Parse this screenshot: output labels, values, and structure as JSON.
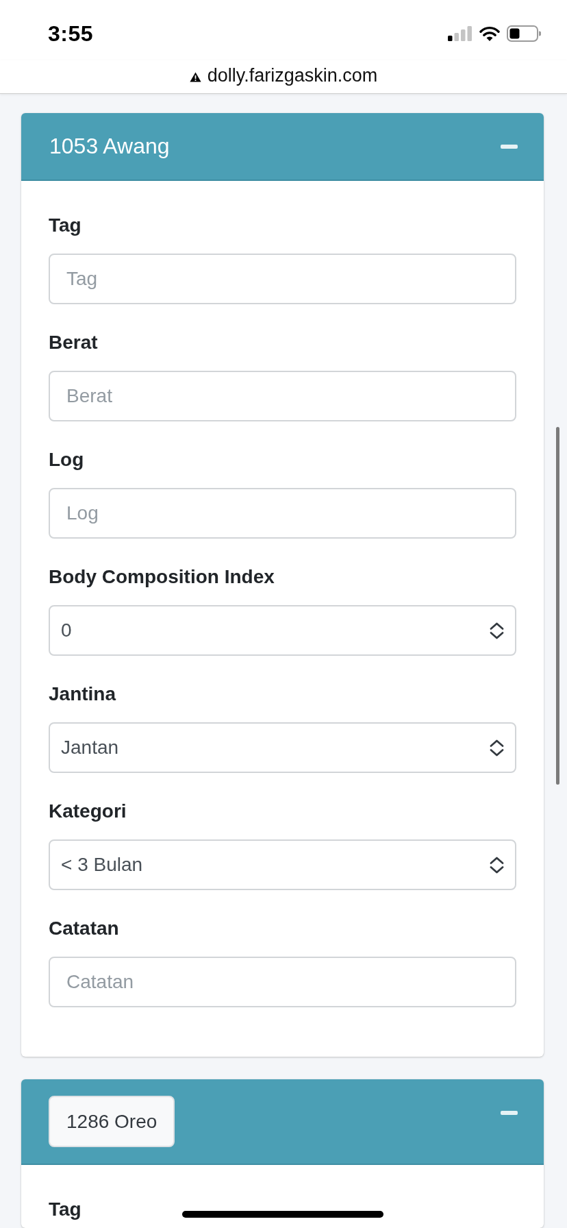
{
  "status_bar": {
    "time": "3:55"
  },
  "address_bar": {
    "url": "dolly.farizgaskin.com"
  },
  "cards": [
    {
      "title": "1053 Awang",
      "expanded": true,
      "fields": [
        {
          "kind": "input",
          "label": "Tag",
          "placeholder": "Tag"
        },
        {
          "kind": "input",
          "label": "Berat",
          "placeholder": "Berat"
        },
        {
          "kind": "input",
          "label": "Log",
          "placeholder": "Log"
        },
        {
          "kind": "select",
          "label": "Body Composition Index",
          "value": "0"
        },
        {
          "kind": "select",
          "label": "Jantina",
          "value": "Jantan"
        },
        {
          "kind": "select",
          "label": "Kategori",
          "value": "< 3 Bulan"
        },
        {
          "kind": "input",
          "label": "Catatan",
          "placeholder": "Catatan"
        }
      ]
    },
    {
      "title_button": "1286 Oreo",
      "expanded": true,
      "fields": [
        {
          "kind": "input",
          "label": "Tag"
        }
      ]
    }
  ]
}
